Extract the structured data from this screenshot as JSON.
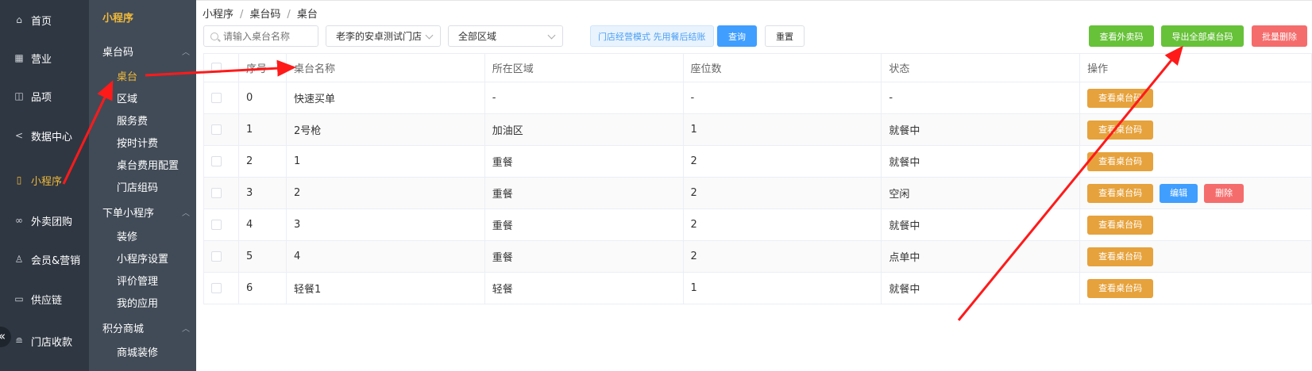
{
  "nav1": {
    "items": [
      {
        "label": "首页",
        "icon": "home-icon"
      },
      {
        "label": "营业",
        "icon": "calendar-icon"
      },
      {
        "label": "品项",
        "icon": "bag-icon"
      },
      {
        "label": "数据中心",
        "icon": "share-icon"
      },
      {
        "label": "小程序",
        "icon": "phone-icon",
        "active": true
      },
      {
        "label": "外卖团购",
        "icon": "bike-icon"
      },
      {
        "label": "会员&营销",
        "icon": "user-icon"
      },
      {
        "label": "供应链",
        "icon": "truck-icon"
      },
      {
        "label": "门店收款",
        "icon": "database-icon"
      }
    ],
    "collapse_glyph": "«"
  },
  "nav2": {
    "title": "小程序",
    "groups": [
      {
        "label": "桌台码",
        "items": [
          "桌台",
          "区域",
          "服务费",
          "按时计费",
          "桌台费用配置",
          "门店组码"
        ]
      },
      {
        "label": "下单小程序",
        "items": [
          "装修",
          "小程序设置",
          "评价管理",
          "我的应用"
        ]
      },
      {
        "label": "积分商城",
        "items": [
          "商城装修"
        ]
      }
    ],
    "active_item": "桌台"
  },
  "breadcrumb": [
    "小程序",
    "桌台码",
    "桌台"
  ],
  "toolbar": {
    "search_placeholder": "请输入桌台名称",
    "store_select": "老李的安卓测试门店",
    "area_select": "全部区域",
    "mode_tag": "门店经营模式 先用餐后结账",
    "query_label": "查询",
    "reset_label": "重置",
    "view_takeout_code": "查看外卖码",
    "export_all_codes": "导出全部桌台码",
    "batch_delete": "批量删除"
  },
  "table": {
    "columns": [
      "序号",
      "桌台名称",
      "所在区域",
      "座位数",
      "状态",
      "操作"
    ],
    "rows": [
      {
        "no": "0",
        "name": "快速买单",
        "area": "-",
        "seats": "-",
        "status": "-",
        "actions": [
          "查看桌台码"
        ]
      },
      {
        "no": "1",
        "name": "2号枪",
        "area": "加油区",
        "seats": "1",
        "status": "就餐中",
        "actions": [
          "查看桌台码"
        ]
      },
      {
        "no": "2",
        "name": "1",
        "area": "重餐",
        "seats": "2",
        "status": "就餐中",
        "actions": [
          "查看桌台码"
        ]
      },
      {
        "no": "3",
        "name": "2",
        "area": "重餐",
        "seats": "2",
        "status": "空闲",
        "actions": [
          "查看桌台码",
          "编辑",
          "删除"
        ]
      },
      {
        "no": "4",
        "name": "3",
        "area": "重餐",
        "seats": "2",
        "status": "就餐中",
        "actions": [
          "查看桌台码"
        ]
      },
      {
        "no": "5",
        "name": "4",
        "area": "重餐",
        "seats": "2",
        "status": "点单中",
        "actions": [
          "查看桌台码"
        ]
      },
      {
        "no": "6",
        "name": "轻餐1",
        "area": "轻餐",
        "seats": "1",
        "status": "就餐中",
        "actions": [
          "查看桌台码"
        ]
      }
    ]
  },
  "colors": {
    "nav_bg": "#2f3742",
    "nav2_bg": "#414b57",
    "accent_yellow": "#f0b93a",
    "primary_blue": "#409eff",
    "green": "#67c23a",
    "orange": "#e6a23c",
    "red": "#f56c6c",
    "annotation_red": "#ff1a1a"
  }
}
